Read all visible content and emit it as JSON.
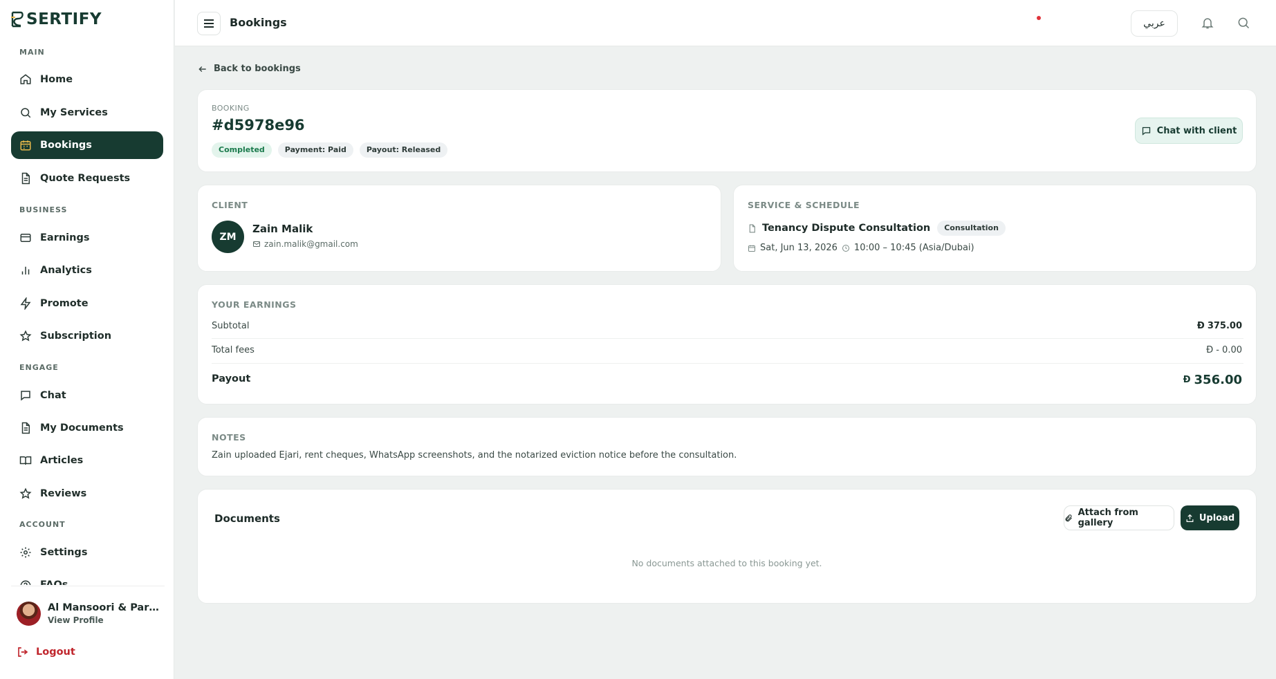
{
  "brand": {
    "name": "SERTIFY"
  },
  "sidebar": {
    "sections": {
      "main": "MAIN",
      "business": "BUSINESS",
      "engage": "ENGAGE",
      "account": "ACCOUNT"
    },
    "items": [
      {
        "label": "Home",
        "icon": "home-icon"
      },
      {
        "label": "My Services",
        "icon": "search-icon"
      },
      {
        "label": "Bookings",
        "icon": "calendar-icon"
      },
      {
        "label": "Quote Requests",
        "icon": "document-icon"
      },
      {
        "label": "Earnings",
        "icon": "card-icon"
      },
      {
        "label": "Analytics",
        "icon": "bar-chart-icon"
      },
      {
        "label": "Promote",
        "icon": "bolt-icon"
      },
      {
        "label": "Subscription",
        "icon": "star-icon"
      },
      {
        "label": "Chat",
        "icon": "chat-icon"
      },
      {
        "label": "My Documents",
        "icon": "document-icon"
      },
      {
        "label": "Articles",
        "icon": "book-icon"
      },
      {
        "label": "Reviews",
        "icon": "star-icon"
      },
      {
        "label": "Settings",
        "icon": "gear-icon"
      },
      {
        "label": "FAQs",
        "icon": "help-icon"
      }
    ],
    "profile": {
      "name": "Al Mansoori & Partne...",
      "link": "View Profile"
    },
    "logout": "Logout"
  },
  "topbar": {
    "title": "Bookings",
    "language": "عربي"
  },
  "booking": {
    "back_label": "Back to bookings",
    "eyebrow": "BOOKING",
    "id": "#d5978e96",
    "status": "Completed",
    "payment": "Payment: Paid",
    "payout": "Payout: Released",
    "chat_button": "Chat with client"
  },
  "client": {
    "eyebrow": "CLIENT",
    "initials": "ZM",
    "name": "Zain Malik",
    "email": "zain.malik@gmail.com"
  },
  "service": {
    "eyebrow": "SERVICE & SCHEDULE",
    "name": "Tenancy Dispute Consultation",
    "type": "Consultation",
    "date": "Sat, Jun 13, 2026",
    "time": "10:00 – 10:45 (Asia/Dubai)"
  },
  "earnings": {
    "eyebrow": "YOUR EARNINGS",
    "currency_symbol": "Đ",
    "subtotal_label": "Subtotal",
    "subtotal_value": "375.00",
    "fees_label": "Total fees",
    "fees_value": "- 0.00",
    "payout_label": "Payout",
    "payout_value": "356.00"
  },
  "notes": {
    "eyebrow": "NOTES",
    "text": "Zain uploaded Ejari, rent cheques, WhatsApp screenshots, and the notarized eviction notice before the consultation."
  },
  "documents": {
    "title": "Documents",
    "attach_button": "Attach from gallery",
    "upload_button": "Upload",
    "empty": "No documents attached to this booking yet."
  },
  "colors": {
    "brand_dark": "#173b31",
    "accent_gold": "#e9b94b",
    "logout_red": "#c0262d",
    "success_green": "#1a7a4c"
  }
}
